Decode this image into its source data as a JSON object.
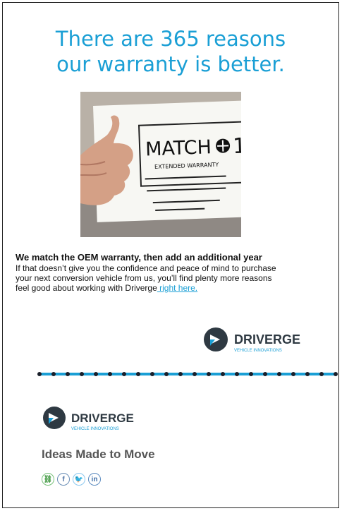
{
  "headline": {
    "line1": "There are 365 reasons",
    "line2": "our warranty is better."
  },
  "photo": {
    "sign_text": "MATCH",
    "sign_subtext": "EXTENDED WARRANTY"
  },
  "body": {
    "bold": "We match the OEM warranty, then add an additional year",
    "line1": "If that doesn’t give you the confidence and peace of mind to purchase",
    "line2": "your next conversion vehicle from us, you’ll find plenty more reasons",
    "line3": "feel good about working with Driverge",
    "link": " right here."
  },
  "brand": {
    "name": "DRIVERGE",
    "subtitle": "VEHICLE INNOVATIONS"
  },
  "footer": {
    "tagline": "Ideas Made to Move"
  },
  "colors": {
    "accent": "#1a9fd5",
    "logo_dark": "#2e3942"
  }
}
